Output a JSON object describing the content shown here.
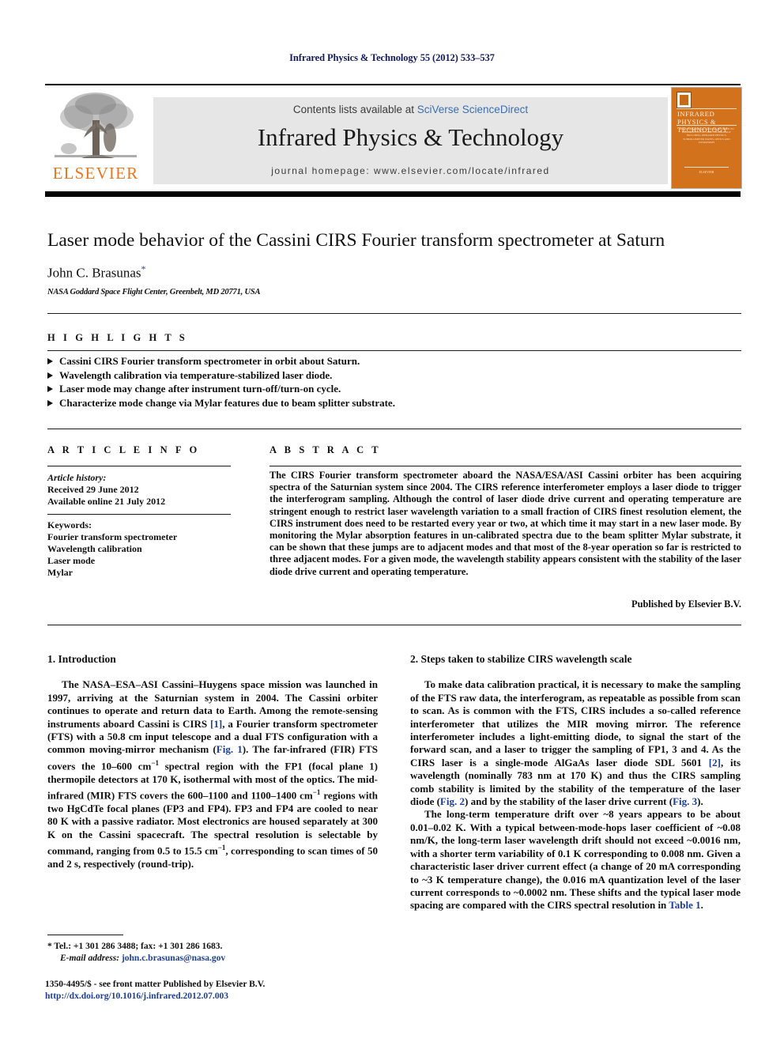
{
  "running_head": "Infrared Physics & Technology 55 (2012) 533–537",
  "masthead": {
    "contents_prefix": "Contents lists available at ",
    "sciverse_link": "SciVerse ScienceDirect",
    "journal_title": "Infrared Physics & Technology",
    "homepage": "journal homepage: www.elsevier.com/locate/infrared",
    "publisher_wordmark": "ELSEVIER",
    "cover": {
      "title": "INFRARED PHYSICS & TECHNOLOGY",
      "subtitle": "AN INTERNATIONAL JOURNAL DEVOTED TO INFRARED PHYSICS AND TECHNOLOGY INCLUDING INFRARED PHYSICS, SUBMILLIMETER WAVES, OPTICS AND ASTRONOMY",
      "footer": "ELSEVIER"
    }
  },
  "article": {
    "title": "Laser mode behavior of the Cassini CIRS Fourier transform spectrometer at Saturn",
    "author": "John C. Brasunas",
    "author_marker": "*",
    "affiliation": "NASA Goddard Space Flight Center, Greenbelt, MD 20771, USA"
  },
  "highlights": {
    "label": "H I G H L I G H T S",
    "items": [
      "Cassini CIRS Fourier transform spectrometer in orbit about Saturn.",
      "Wavelength calibration via temperature-stabilized laser diode.",
      "Laser mode may change after instrument turn-off/turn-on cycle.",
      "Characterize mode change via Mylar features due to beam splitter substrate."
    ]
  },
  "article_info": {
    "label": "A R T I C L E   I N F O",
    "history_label": "Article history:",
    "received": "Received 29 June 2012",
    "available_online": "Available online 21 July 2012",
    "keywords_label": "Keywords:",
    "keywords": [
      "Fourier transform spectrometer",
      "Wavelength calibration",
      "Laser mode",
      "Mylar"
    ]
  },
  "abstract": {
    "label": "A B S T R A C T",
    "text": "The CIRS Fourier transform spectrometer aboard the NASA/ESA/ASI Cassini orbiter has been acquiring spectra of the Saturnian system since 2004. The CIRS reference interferometer employs a laser diode to trigger the interferogram sampling. Although the control of laser diode drive current and operating temperature are stringent enough to restrict laser wavelength variation to a small fraction of CIRS finest resolution element, the CIRS instrument does need to be restarted every year or two, at which time it may start in a new laser mode. By monitoring the Mylar absorption features in un-calibrated spectra due to the beam splitter Mylar substrate, it can be shown that these jumps are to adjacent modes and that most of the 8-year operation so far is restricted to three adjacent modes. For a given mode, the wavelength stability appears consistent with the stability of the laser diode drive current and operating temperature.",
    "published_by": "Published by Elsevier B.V."
  },
  "body": {
    "section1": {
      "title": "1. Introduction",
      "paragraph1_a": "The NASA–ESA–ASI Cassini–Huygens space mission was launched in 1997, arriving at the Saturnian system in 2004. The Cassini orbiter continues to operate and return data to Earth. Among the remote-sensing instruments aboard Cassini is CIRS ",
      "ref1": "[1]",
      "paragraph1_b": ", a Fourier transform spectrometer (FTS) with a 50.8 cm input telescope and a dual FTS configuration with a common moving-mirror mechanism (",
      "fig1": "Fig. 1",
      "paragraph1_c": "). The far-infrared (FIR) FTS covers the 10–600 cm",
      "sup_minus1_a": "−1",
      "paragraph1_d": " spectral region with the FP1 (focal plane 1) thermopile detectors at 170 K, isothermal with most of the optics. The mid-infrared (MIR) FTS covers the 600–1100 and 1100–1400 cm",
      "sup_minus1_b": "−1",
      "paragraph1_e": " regions with two HgCdTe focal planes (FP3 and FP4). FP3 and FP4 are cooled to near 80 K with a passive radiator. Most electronics are housed separately at 300 K on the Cassini spacecraft. The spectral resolution is selectable by command, ranging from 0.5 to 15.5 cm",
      "sup_minus1_c": "−1",
      "paragraph1_f": ", corresponding to scan times of 50 and 2 s, respectively (round-trip)."
    },
    "section2": {
      "title": "2. Steps taken to stabilize CIRS wavelength scale",
      "paragraph1_a": "To make data calibration practical, it is necessary to make the sampling of the FTS raw data, the interferogram, as repeatable as possible from scan to scan. As is common with the FTS, CIRS includes a so-called reference interferometer that utilizes the MIR moving mirror. The reference interferometer includes a light-emitting diode, to signal the start of the forward scan, and a laser to trigger the sampling of FP1, 3 and 4. As the CIRS laser is a single-mode AlGaAs laser diode SDL 5601 ",
      "ref2": "[2]",
      "paragraph1_b": ", its wavelength (nominally 783 nm at 170 K) and thus the CIRS sampling comb stability is limited by the stability of the temperature of the laser diode (",
      "fig2": "Fig. 2",
      "paragraph1_c": ") and by the stability of the laser drive current (",
      "fig3": "Fig. 3",
      "paragraph1_d": ").",
      "paragraph2_a": "The long-term temperature drift over ~8 years appears to be about 0.01–0.02 K. With a typical between-mode-hops laser coefficient of ~0.08 nm/K, the long-term laser wavelength drift should not exceed ~0.0016 nm, with a shorter term variability of 0.1 K corresponding to 0.008 nm. Given a characteristic laser driver current effect (a change of 20 mA corresponding to ~3 K temperature change), the 0.016 mA quantization level of the laser current corresponds to ~0.0002 nm. These shifts and the typical laser mode spacing are compared with the CIRS spectral resolution in ",
      "table1": "Table 1",
      "paragraph2_b": "."
    }
  },
  "footnotes": {
    "marker": "*",
    "contact": "Tel.: +1 301 286 3488; fax: +1 301 286 1683.",
    "email_label": "E-mail address:",
    "email": "john.c.brasunas@nasa.gov"
  },
  "imprint": {
    "issn_line": "1350-4495/$ - see front matter Published by Elsevier B.V.",
    "doi": "http://dx.doi.org/10.1016/j.infrared.2012.07.003"
  },
  "colors": {
    "running_head": "#131a5e",
    "link_blue": "#1c3f94",
    "sciverse_blue": "#3a6fb0",
    "elsevier_orange": "#e87722",
    "cover_orange": "#d2721c",
    "band_gray": "#e6e6e6"
  }
}
